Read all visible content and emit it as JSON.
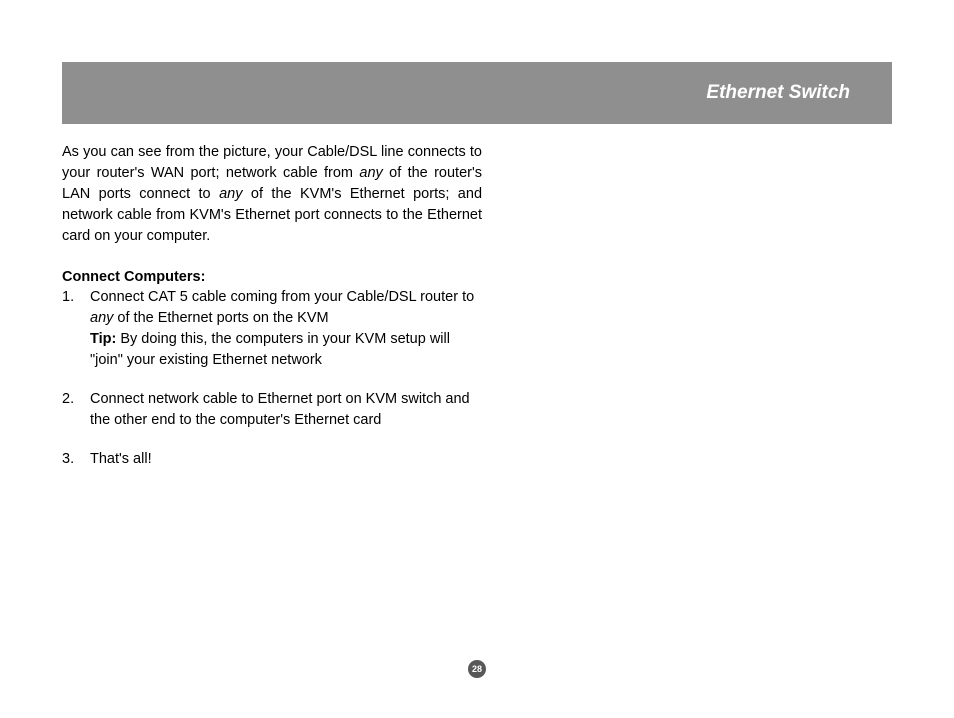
{
  "header": {
    "title": "Ethernet Switch"
  },
  "intro": {
    "part1": "As you can see from the picture, your Cable/DSL line connects to your router's WAN port; network cable from ",
    "em1": "any",
    "part2": " of the router's LAN ports connect to ",
    "em2": "any",
    "part3": " of the KVM's Ethernet ports; and network cable from KVM's Ethernet port connects to the Ethernet card on your computer."
  },
  "section": {
    "heading": "Connect Computers:"
  },
  "steps": [
    {
      "number": "1.",
      "line1_a": "Connect CAT 5 cable coming from your Cable/DSL router to ",
      "line1_em": "any",
      "line1_b": " of the Ethernet ports on the KVM",
      "tip_label": "Tip:",
      "tip_text": "  By doing this, the computers in your KVM setup will \"join\" your existing Ethernet network"
    },
    {
      "number": "2.",
      "text": "Connect network cable to Ethernet port on KVM switch and the other end to the computer's Ethernet card"
    },
    {
      "number": "3.",
      "text": "That's all!"
    }
  ],
  "page_number": "28"
}
